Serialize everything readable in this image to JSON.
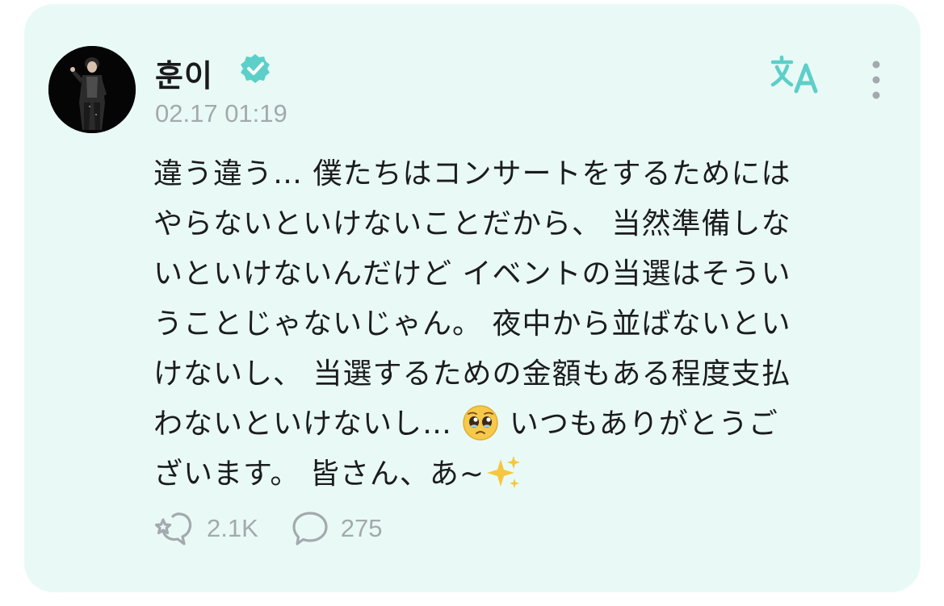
{
  "post": {
    "author": "훈이",
    "verified": true,
    "timestamp": "02.17 01:19",
    "text_before_emoji": "違う違う… 僕たちはコンサートをするためには\nやらないといけないことだから、 当然準備しな\nいといけないんだけど イベントの当選はそうい\nうことじゃないじゃん。 夜中から並ばないとい\nけないし、 当選するための金額もある程度支払\nわないといけないし… ",
    "emoji_1": "pleading-face",
    "text_after_emoji": " いつもありがとうご\nざいます。 皆さん、あ~",
    "emoji_2": "sparkles",
    "likes": "2.1K",
    "comments": "275"
  },
  "icons": {
    "verified": "verified-badge-icon",
    "translate": "translate-icon",
    "more": "more-vertical-icon",
    "like": "like-icon",
    "comment": "comment-icon"
  },
  "colors": {
    "card_background": "#e9faf6",
    "accent": "#5ccfc8",
    "muted_text": "#a3a9ad",
    "body_text": "#1c1c1c"
  }
}
